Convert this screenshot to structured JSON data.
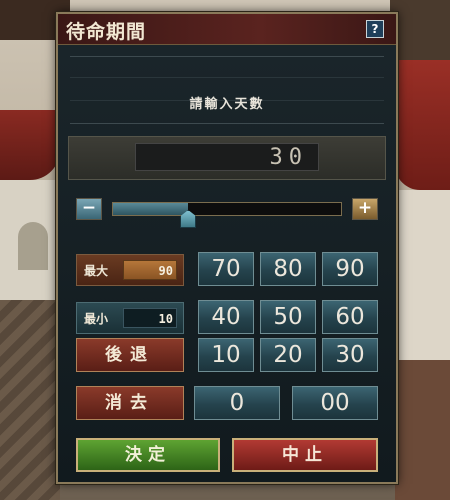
{
  "dialog": {
    "title": "待命期間",
    "help_label": "?",
    "prompt": "請輸入天數"
  },
  "value": {
    "current": "30"
  },
  "slider": {
    "minus_label": "−",
    "plus_label": "+",
    "level_fraction": 0.33
  },
  "limits": {
    "max_label": "最大",
    "max_value": "90",
    "min_label": "最小",
    "min_value": "10"
  },
  "keypad": {
    "row1": [
      "70",
      "80",
      "90"
    ],
    "row2": [
      "40",
      "50",
      "60"
    ],
    "row3": [
      "10",
      "20",
      "30"
    ],
    "row4": [
      "0",
      "00"
    ]
  },
  "actions": {
    "back_label": "後退",
    "clear_label": "消去",
    "confirm_label": "決定",
    "cancel_label": "中止"
  },
  "colors": {
    "title_bar": "#5a231f",
    "confirm": "#4a8a28",
    "cancel": "#9a2e28",
    "keypad": "#2e5561"
  }
}
